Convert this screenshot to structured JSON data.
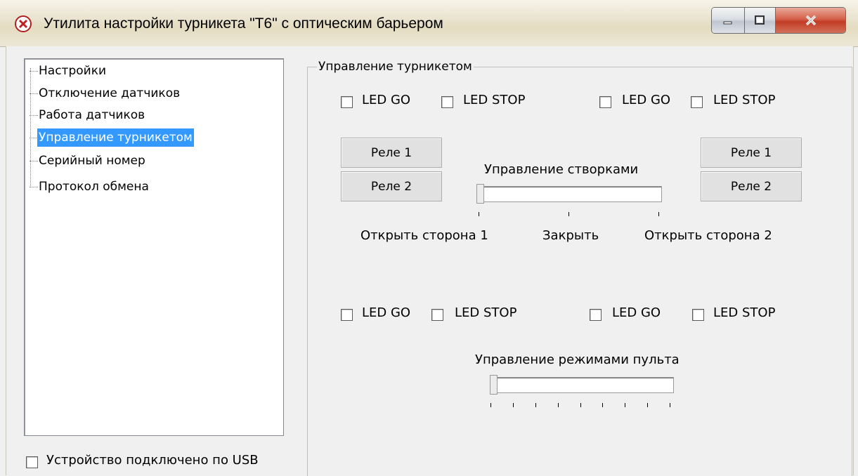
{
  "window": {
    "title": "Утилита настройки турникета \"Т6\" с оптическим барьером"
  },
  "tree": {
    "items": [
      {
        "label": "Настройки",
        "selected": false
      },
      {
        "label": "Отключение датчиков",
        "selected": false
      },
      {
        "label": "Работа датчиков",
        "selected": false
      },
      {
        "label": "Управление турникетом",
        "selected": true
      },
      {
        "label": "Серийный номер",
        "selected": false
      },
      {
        "label": "Протокол обмена",
        "selected": false
      }
    ]
  },
  "usb": {
    "label": "Устройство подключено по USB",
    "checked": false
  },
  "group": {
    "title": "Управление турникетом"
  },
  "leds_top": [
    {
      "label": "LED GO",
      "checked": false
    },
    {
      "label": "LED STOP",
      "checked": false
    },
    {
      "label": "LED GO",
      "checked": false
    },
    {
      "label": "LED STOP",
      "checked": false
    }
  ],
  "relays_left": [
    "Реле 1",
    "Реле 2"
  ],
  "relays_right": [
    "Реле 1",
    "Реле 2"
  ],
  "doors": {
    "title": "Управление створками",
    "positions": [
      "Открыть сторона 1",
      "Закрыть",
      "Открыть сторона 2"
    ],
    "value": 0
  },
  "leds_bottom": [
    {
      "label": "LED GO",
      "checked": false
    },
    {
      "label": "LED STOP",
      "checked": false
    },
    {
      "label": "LED GO",
      "checked": false
    },
    {
      "label": "LED STOP",
      "checked": false
    }
  ],
  "remote": {
    "title": "Управление режимами пульта",
    "value": 0,
    "tick_count": 9
  },
  "colors": {
    "selection": "#3399ff",
    "window_bg": "#f0f0f0"
  }
}
